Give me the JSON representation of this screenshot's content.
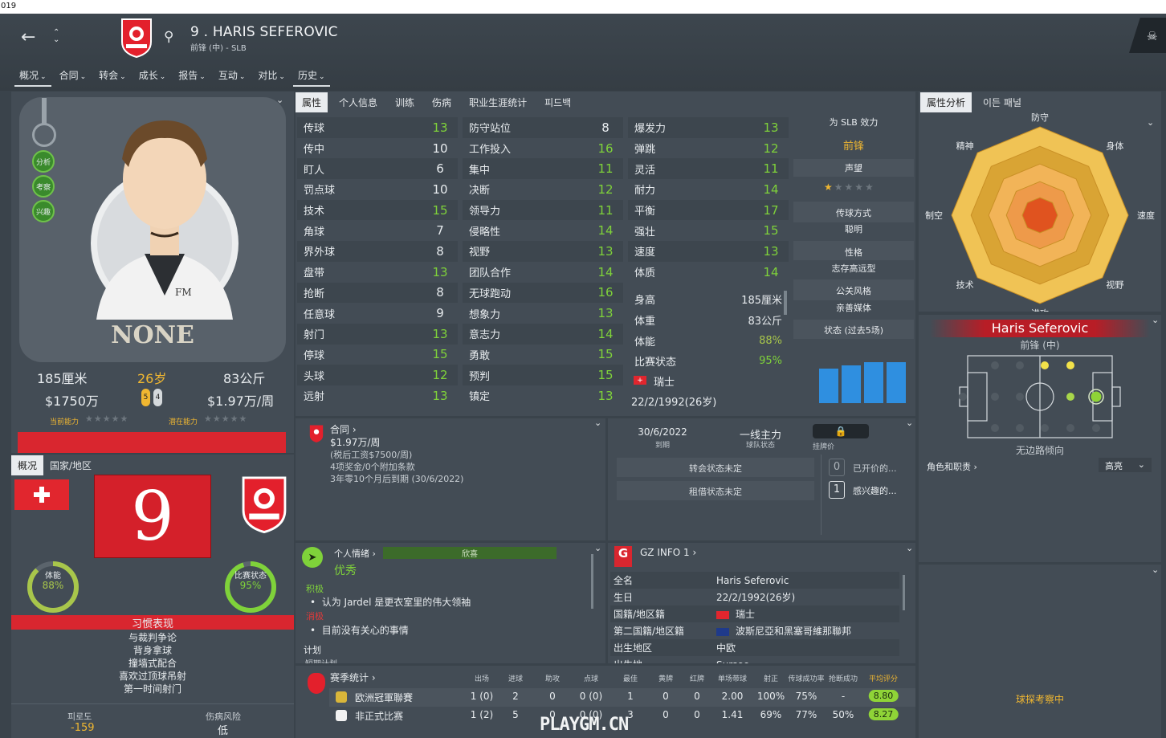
{
  "window": {
    "title_fragment": "019"
  },
  "header": {
    "player_title": "9 . HARIS SEFEROVIC",
    "player_sub": "前锋 (中) - SLB",
    "back_icon": "arrow-left-icon",
    "menu": [
      {
        "label": "概况",
        "active": true
      },
      {
        "label": "合同"
      },
      {
        "label": "转会"
      },
      {
        "label": "成长"
      },
      {
        "label": "报告"
      },
      {
        "label": "互动"
      },
      {
        "label": "对比"
      },
      {
        "label": "历史",
        "active": true
      }
    ]
  },
  "left": {
    "side_buttons": [
      "分析",
      "考察",
      "兴趣"
    ],
    "face_caption": "NONE",
    "height": "185厘米",
    "age": "26岁",
    "weight": "83公斤",
    "value": "$1750万",
    "wage": "$1.97万/周",
    "ca_label": "当前能力",
    "pa_label": "潜在能力",
    "star_badges": [
      "5",
      "4"
    ],
    "tabs": [
      "概况",
      "国家/地区"
    ],
    "shirt_number": "9",
    "fitness_label": "体能",
    "fitness_value": "88%",
    "form_label": "比赛状态",
    "form_value": "95%",
    "habits_title": "习惯表现",
    "habits": [
      "与裁判争论",
      "背身拿球",
      "撞墙式配合",
      "喜欢过顶球吊射",
      "第一时间射门"
    ],
    "fatigue_label": "피로도",
    "fatigue_value": "-159",
    "injury_label": "伤病风险",
    "injury_value": "低"
  },
  "attributes": {
    "tabs": [
      "属性",
      "个人信息",
      "训练",
      "伤病",
      "职业生涯统计",
      "피드백"
    ],
    "col1": [
      {
        "name": "传球",
        "value": "13",
        "c": "g"
      },
      {
        "name": "传中",
        "value": "10",
        "c": "w"
      },
      {
        "name": "盯人",
        "value": "6",
        "c": "w"
      },
      {
        "name": "罚点球",
        "value": "10",
        "c": "w"
      },
      {
        "name": "技术",
        "value": "15",
        "c": "g"
      },
      {
        "name": "角球",
        "value": "7",
        "c": "w"
      },
      {
        "name": "界外球",
        "value": "8",
        "c": "w"
      },
      {
        "name": "盘带",
        "value": "13",
        "c": "g"
      },
      {
        "name": "抢断",
        "value": "8",
        "c": "w"
      },
      {
        "name": "任意球",
        "value": "9",
        "c": "w"
      },
      {
        "name": "射门",
        "value": "13",
        "c": "g"
      },
      {
        "name": "停球",
        "value": "15",
        "c": "g"
      },
      {
        "name": "头球",
        "value": "12",
        "c": "g"
      },
      {
        "name": "远射",
        "value": "13",
        "c": "g"
      }
    ],
    "col2": [
      {
        "name": "防守站位",
        "value": "8",
        "c": "w"
      },
      {
        "name": "工作投入",
        "value": "16",
        "c": "g"
      },
      {
        "name": "集中",
        "value": "11",
        "c": "g"
      },
      {
        "name": "决断",
        "value": "12",
        "c": "g"
      },
      {
        "name": "领导力",
        "value": "11",
        "c": "g"
      },
      {
        "name": "侵略性",
        "value": "14",
        "c": "g"
      },
      {
        "name": "视野",
        "value": "13",
        "c": "g"
      },
      {
        "name": "团队合作",
        "value": "14",
        "c": "g"
      },
      {
        "name": "无球跑动",
        "value": "16",
        "c": "g"
      },
      {
        "name": "想象力",
        "value": "13",
        "c": "g"
      },
      {
        "name": "意志力",
        "value": "14",
        "c": "g"
      },
      {
        "name": "勇敢",
        "value": "15",
        "c": "g"
      },
      {
        "name": "预判",
        "value": "15",
        "c": "g"
      },
      {
        "name": "镇定",
        "value": "13",
        "c": "g"
      }
    ],
    "col3": [
      {
        "name": "爆发力",
        "value": "13",
        "c": "g"
      },
      {
        "name": "弹跳",
        "value": "12",
        "c": "g"
      },
      {
        "name": "灵活",
        "value": "11",
        "c": "g"
      },
      {
        "name": "耐力",
        "value": "14",
        "c": "g"
      },
      {
        "name": "平衡",
        "value": "17",
        "c": "g"
      },
      {
        "name": "强壮",
        "value": "15",
        "c": "g"
      },
      {
        "name": "速度",
        "value": "13",
        "c": "g"
      },
      {
        "name": "体质",
        "value": "14",
        "c": "g"
      }
    ],
    "info": [
      {
        "name": "身高",
        "value": "185厘米"
      },
      {
        "name": "体重",
        "value": "83公斤"
      },
      {
        "name": "体能",
        "value": "88%"
      },
      {
        "name": "比赛状态",
        "value": "95%"
      }
    ],
    "nation": "瑞士",
    "dob": "22/2/1992(26岁)",
    "side": {
      "plays_for": "为 SLB 效力",
      "position": "前锋",
      "reputation_label": "声望",
      "reputation_stars": 1,
      "pass_style_label": "传球方式",
      "pass_style_value": "聪明",
      "personality_label": "性格",
      "personality_value": "志存高远型",
      "media_label": "公关风格",
      "media_value": "亲善媒体",
      "form_label": "状态 (过去5场)",
      "form_bars": [
        0.82,
        0.9,
        0.98,
        0.98
      ]
    }
  },
  "contract": {
    "title": "合同 ›",
    "wage": "$1.97万/周",
    "pretax": "(税后工资$7500/周)",
    "bonuses": "4项奖金/0个附加条款",
    "expiry_text": "3年零10个月后到期 (30/6/2022)"
  },
  "status": {
    "expiry_date": "30/6/2022",
    "expiry_label": "到期",
    "squad_status": "一线主力",
    "squad_label": "球队状态",
    "price_label": "挂牌价",
    "transfer_status": "转会状态未定",
    "loan_status": "租借状态未定",
    "offers_count": "0",
    "offers_label": "已开价的...",
    "interest_count": "1",
    "interest_label": "感兴趣的..."
  },
  "mood": {
    "title": "个人情绪 ›",
    "bar_label": "欣喜",
    "state": "优秀",
    "positive_label": "积极",
    "positive_item": "认为 Jardel 是更衣室里的伟大领袖",
    "negative_label": "消极",
    "negative_item": "目前没有关心的事情",
    "plan_label": "计划",
    "plan_cut": "短期计划"
  },
  "gz": {
    "title": "GZ INFO 1 ›",
    "rows": [
      {
        "k": "全名",
        "v": "Haris Seferovic"
      },
      {
        "k": "生日",
        "v": "22/2/1992(26岁)"
      },
      {
        "k": "国籍/地区籍",
        "v": "瑞士",
        "flag": "ch"
      },
      {
        "k": "第二国籍/地区籍",
        "v": "波斯尼亞和黑塞哥維那聯邦",
        "flag": "ba"
      },
      {
        "k": "出生地区",
        "v": "中欧"
      },
      {
        "k": "出生地",
        "v": "Sursee"
      }
    ]
  },
  "season": {
    "title": "赛季统计 ›",
    "headers": [
      "出场",
      "进球",
      "助攻",
      "点球",
      "最佳",
      "黄牌",
      "红牌",
      "单场带球",
      "射正",
      "传球成功率",
      "抢断成功",
      "平均评分"
    ],
    "rows": [
      {
        "comp": "欧洲冠軍聯賽",
        "vals": [
          "1 (0)",
          "2",
          "0",
          "0 (0)",
          "1",
          "0",
          "0",
          "2.00",
          "100%",
          "75%",
          "-",
          "8.80"
        ]
      },
      {
        "comp": "非正式比赛",
        "vals": [
          "1 (2)",
          "5",
          "0",
          "0 (0)",
          "3",
          "0",
          "0",
          "1.41",
          "69%",
          "77%",
          "50%",
          "8.27"
        ]
      }
    ]
  },
  "radar": {
    "tabs": [
      "属性分析",
      "이든 패널"
    ],
    "axes": [
      "防守",
      "身体",
      "速度",
      "视野",
      "进攻",
      "技术",
      "制空",
      "精神"
    ]
  },
  "pitch": {
    "name": "Haris Seferovic",
    "position": "前锋 (中)",
    "foot": "无边路倾向",
    "roles_label": "角色和职责 ›",
    "dropdown": "高亮"
  },
  "scouting": {
    "text": "球探考察中"
  },
  "watermark": "PLAYGM.CN",
  "colors": {
    "accent_green": "#7fd23a",
    "accent_yellow": "#f0b731",
    "accent_red": "#d9262f"
  }
}
